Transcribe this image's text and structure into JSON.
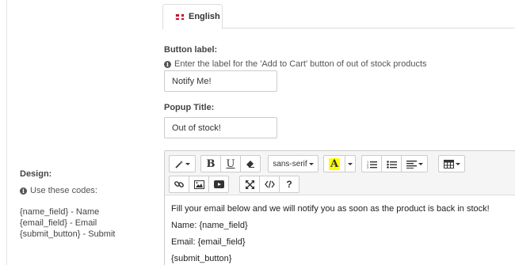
{
  "tabs": [
    {
      "label": "English"
    }
  ],
  "button_label": {
    "title": "Button label:",
    "help": "Enter the label for the 'Add to Cart' button of out of stock products",
    "value": "Notify Me!"
  },
  "popup_title": {
    "title": "Popup Title:",
    "value": "Out of stock!"
  },
  "design": {
    "title": "Design:",
    "help": "Use these codes:",
    "codes": [
      "{name_field} - Name",
      "{email_field} - Email",
      "{submit_button} - Submit"
    ]
  },
  "editor": {
    "toolbar": {
      "font_family": "sans-serif",
      "font_color_letter": "A"
    },
    "content": [
      "Fill your email below and we will notify you as soon as the product is back in stock!",
      "Name: {name_field}",
      "Email: {email_field}",
      "{submit_button}"
    ]
  }
}
